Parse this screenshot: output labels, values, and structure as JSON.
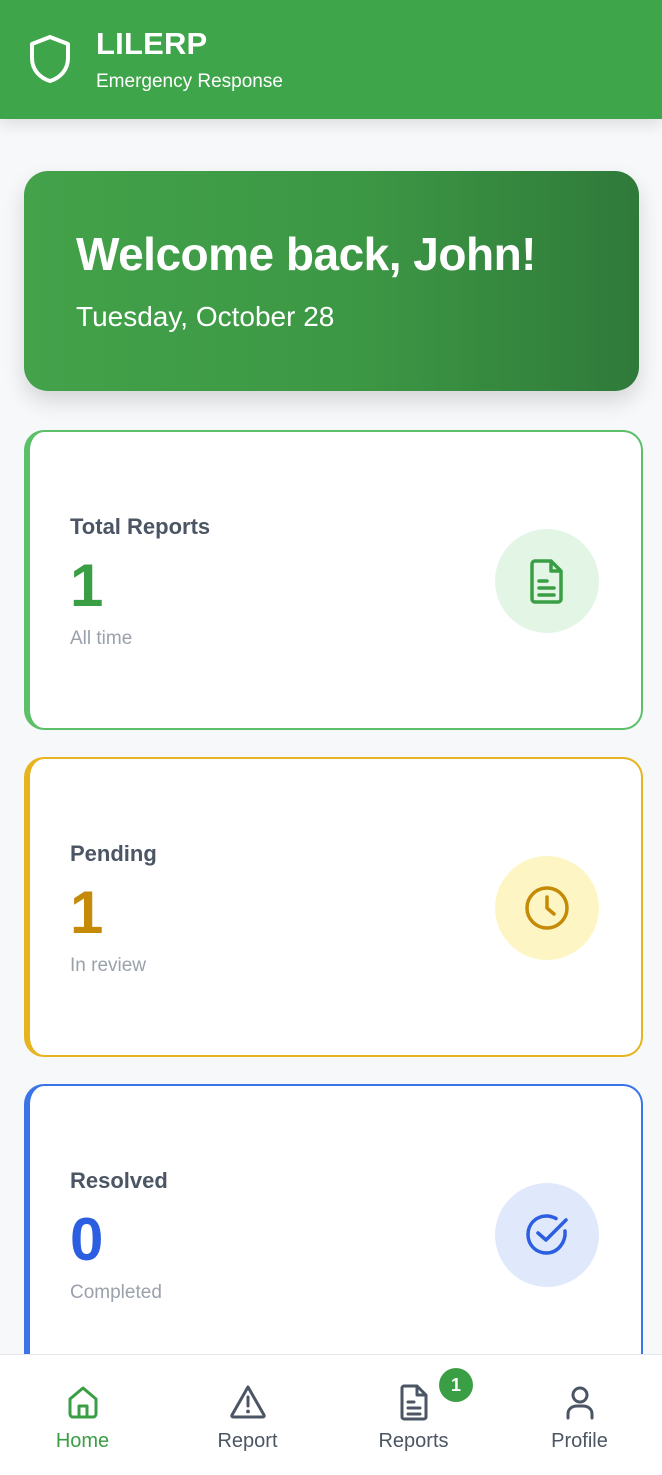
{
  "header": {
    "title": "LILERP",
    "subtitle": "Emergency Response",
    "icon": "shield-icon"
  },
  "welcome": {
    "title": "Welcome back, John!",
    "date": "Tuesday, October 28"
  },
  "stats": [
    {
      "label": "Total Reports",
      "value": "1",
      "caption": "All time",
      "icon": "document-icon",
      "accent": "#3a9e45"
    },
    {
      "label": "Pending",
      "value": "1",
      "caption": "In review",
      "icon": "clock-icon",
      "accent": "#c58a08"
    },
    {
      "label": "Resolved",
      "value": "0",
      "caption": "Completed",
      "icon": "check-circle-icon",
      "accent": "#2b5ee0"
    }
  ],
  "nav": {
    "items": [
      {
        "label": "Home",
        "icon": "home-icon",
        "active": true
      },
      {
        "label": "Report",
        "icon": "warning-icon",
        "active": false
      },
      {
        "label": "Reports",
        "icon": "document-icon",
        "active": false
      },
      {
        "label": "Profile",
        "icon": "user-icon",
        "active": false
      }
    ],
    "reports_badge": "1"
  },
  "colors": {
    "primary": "#3fa54a",
    "pending": "#e6b41e",
    "resolved": "#3b73e8"
  }
}
